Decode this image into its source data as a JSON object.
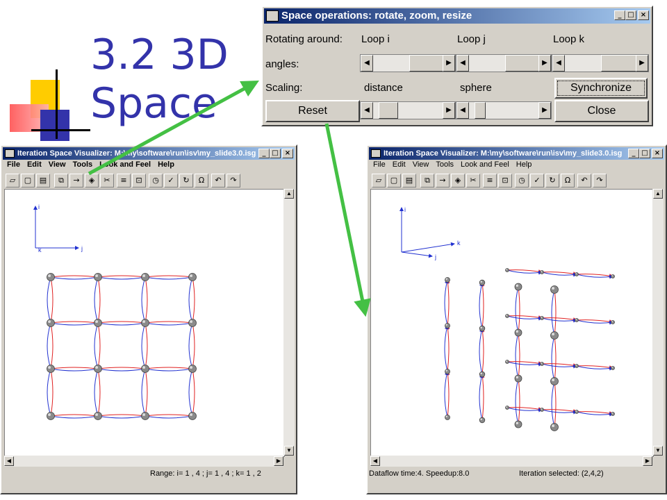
{
  "slide": {
    "title_line1": "3.2 3D",
    "title_line2": "Space"
  },
  "dialog": {
    "title": "Space operations: rotate, zoom, resize",
    "rotating_label": "Rotating around:",
    "loop_i": "Loop i",
    "loop_j": "Loop j",
    "loop_k": "Loop k",
    "angles_label": "angles:",
    "scaling_label": "Scaling:",
    "distance_label": "distance",
    "sphere_label": "sphere",
    "synchronize_button": "Synchronize",
    "reset_button": "Reset",
    "close_button": "Close"
  },
  "left_window": {
    "title": "Iteration Space Visualizer: M:\\my\\software\\run\\isv\\my_slide3.0.isg",
    "menu": [
      "File",
      "Edit",
      "View",
      "Tools",
      "Look and Feel",
      "Help"
    ],
    "axis_i": "i",
    "axis_k": "k",
    "axis_j": "j",
    "status_range": "Range: i= 1 , 4 ; j= 1 , 4 ; k= 1 , 2"
  },
  "right_window": {
    "title": "Iteration Space Visualizer: M:\\my\\software\\run\\isv\\my_slide3.0.isg",
    "menu": [
      "File",
      "Edit",
      "View",
      "Tools",
      "Look and Feel",
      "Help"
    ],
    "axis_i": "i",
    "axis_k": "k",
    "axis_j": "j",
    "status_dataflow": "Dataflow time:4. Speedup:8.0",
    "status_selected": "Iteration selected: (2,4,2)"
  },
  "toolbar_icons": [
    "open-icon",
    "new-icon",
    "print-icon",
    "copy-icon",
    "arrow-right-icon",
    "transform-icon",
    "cut-icon",
    "text-icon",
    "zoom-icon",
    "clock-icon",
    "spellcheck-icon",
    "refresh-icon",
    "omega-icon",
    "undo-icon",
    "redo-icon"
  ],
  "colors": {
    "title_text": "#3333aa",
    "arrow_green": "#44c044",
    "edge_red": "#e02020",
    "edge_blue": "#2030d0",
    "window_face": "#d4d0c8",
    "titlebar_start": "#0a246a",
    "titlebar_end": "#a6caf0"
  }
}
